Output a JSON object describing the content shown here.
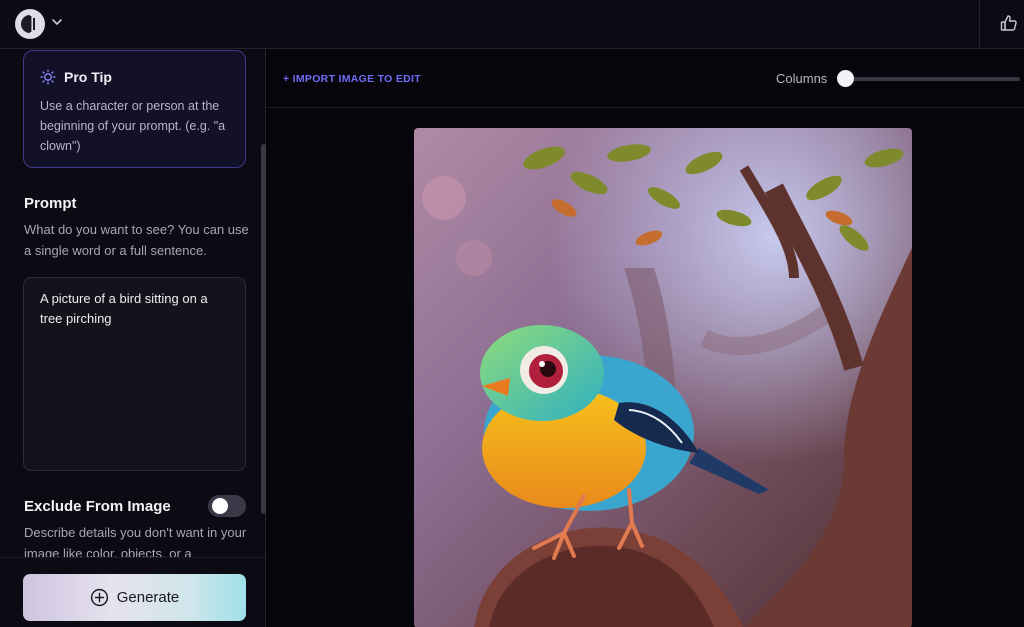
{
  "header": {
    "logo_icon": "logo-icon",
    "chevron_icon": "chevron-down-icon",
    "feedback_icon": "thumbs-up-icon"
  },
  "sidebar": {
    "pro_tip": {
      "icon": "lightbulb-icon",
      "title": "Pro Tip",
      "text": "Use a character or person at the beginning of your prompt. (e.g. \"a clown\")"
    },
    "prompt": {
      "title": "Prompt",
      "description": "What do you want to see? You can use a single word or a full sentence.",
      "value": "A picture of a bird sitting on a tree pirching"
    },
    "exclude": {
      "title": "Exclude From Image",
      "description": "Describe details you don't want in your image like color, objects, or a",
      "toggle_on": false
    },
    "generate_label": "Generate",
    "generate_icon": "plus-circle-icon"
  },
  "main": {
    "import_label": "+ IMPORT IMAGE TO EDIT",
    "columns_label": "Columns",
    "columns_slider_value": 0
  },
  "colors": {
    "accent": "#6f6cf6",
    "protip_border": "#3f3a8a",
    "background": "#0a0710"
  }
}
